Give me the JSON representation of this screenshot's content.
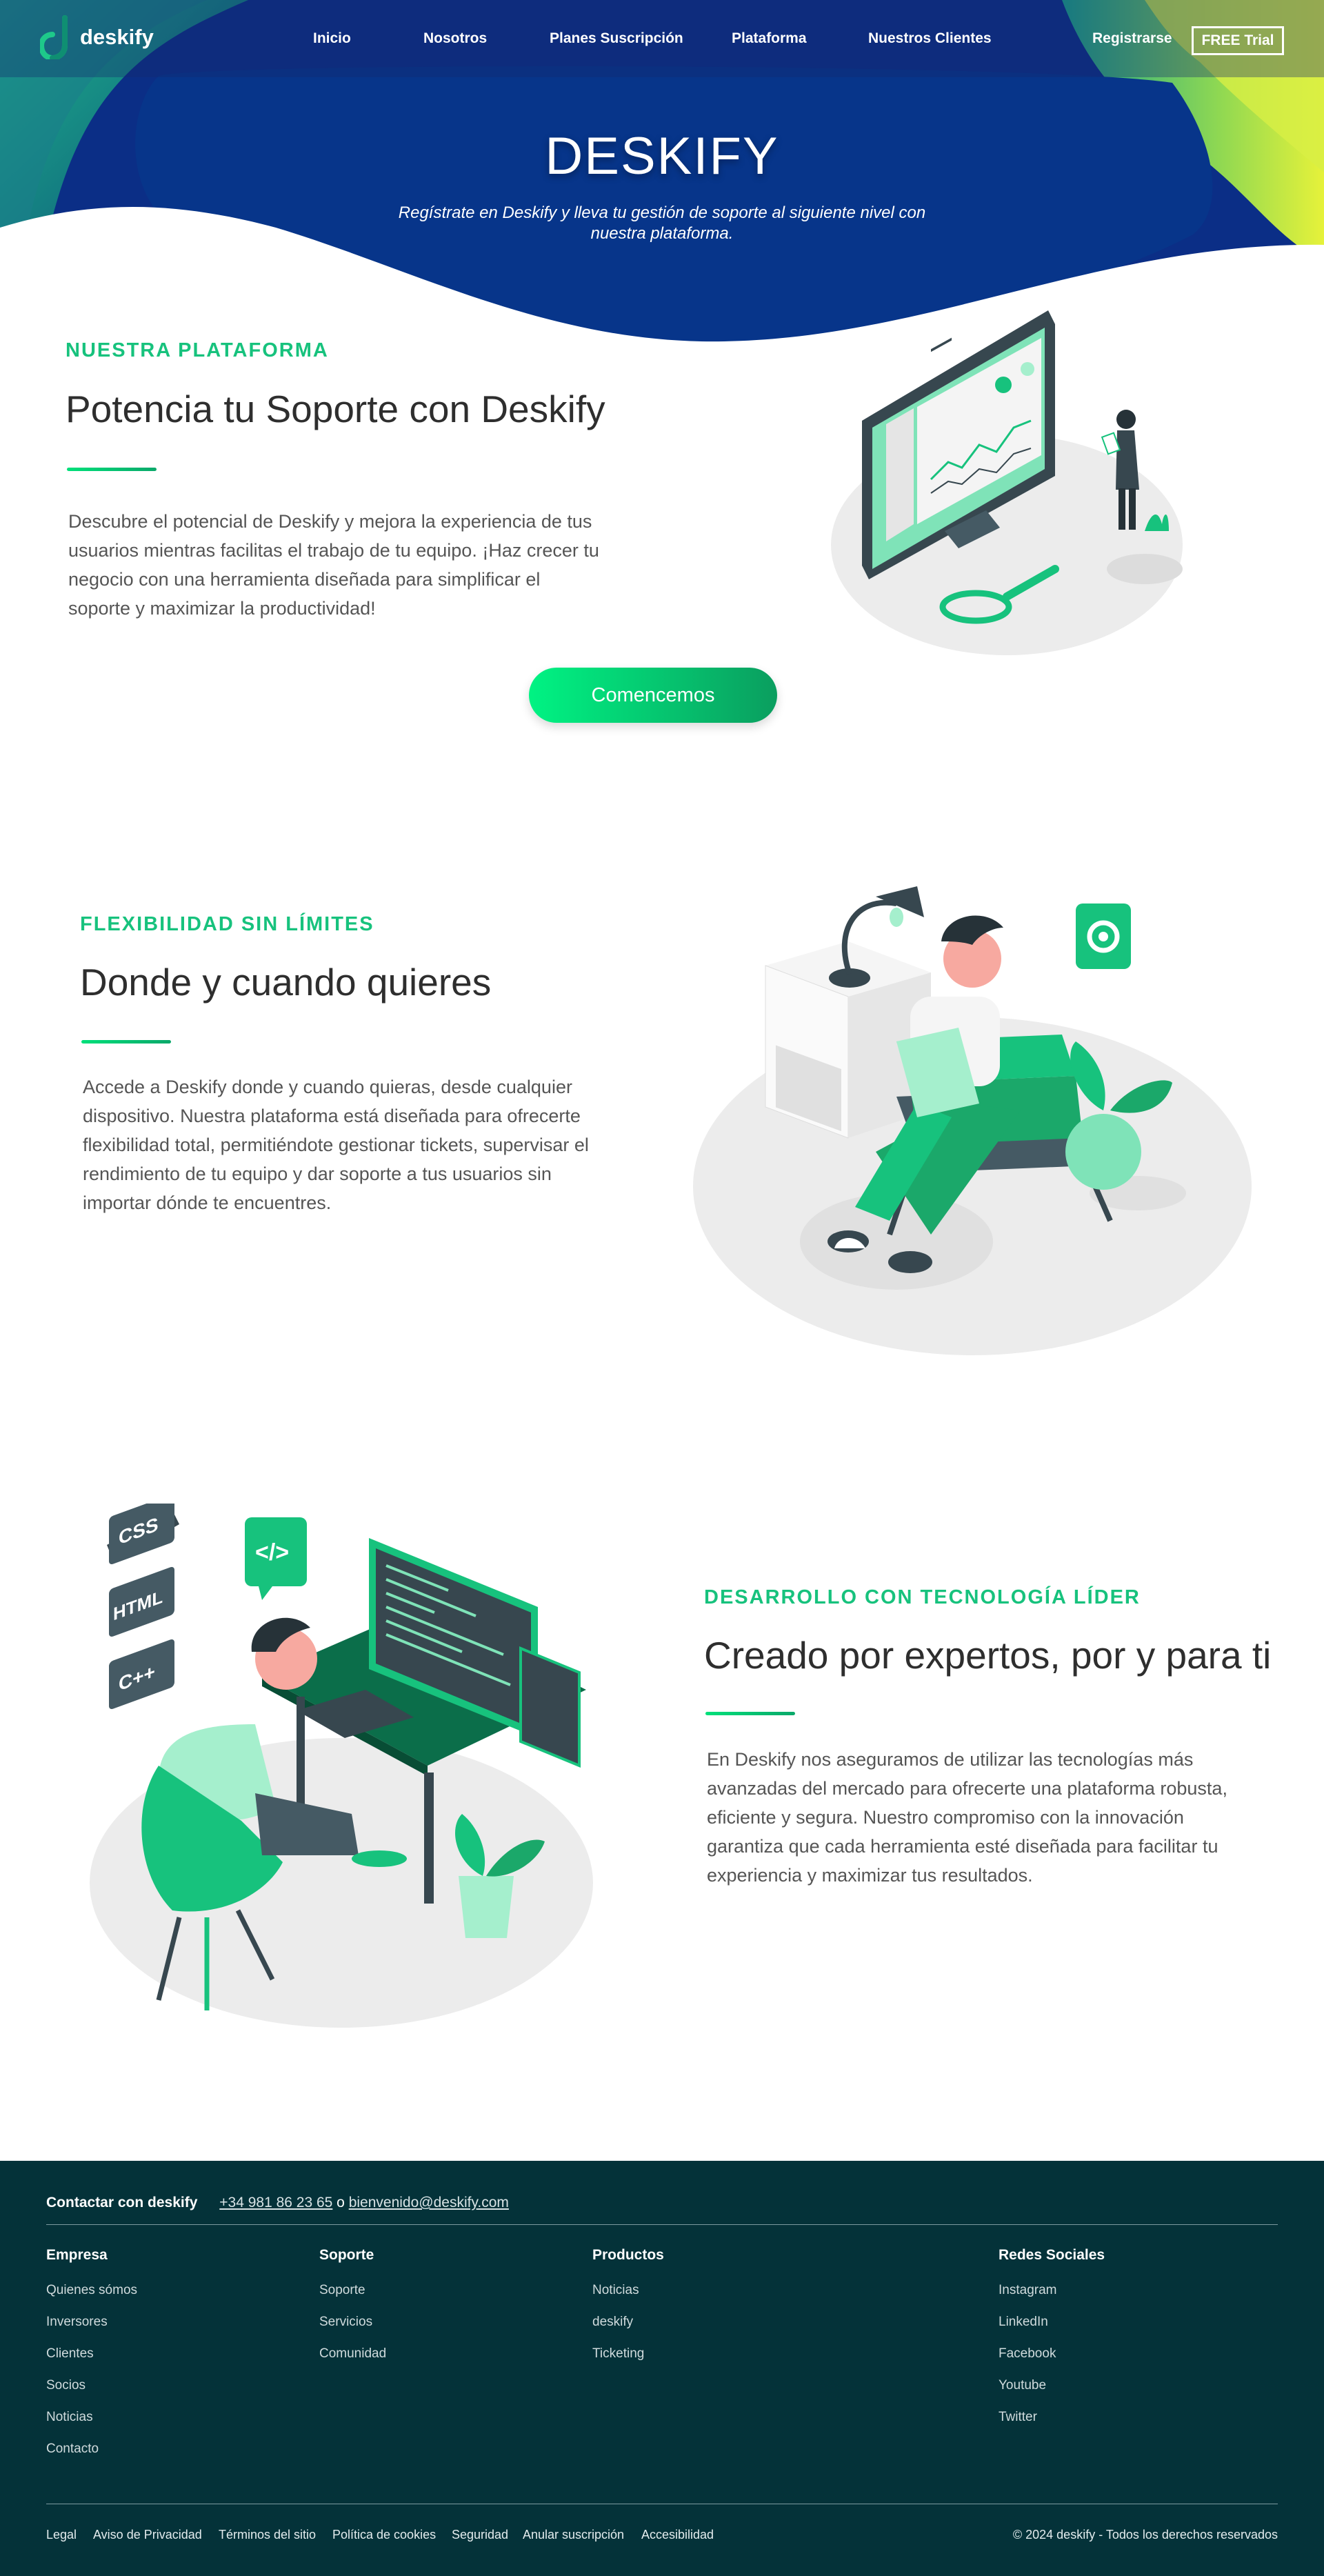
{
  "brand": {
    "name": "deskify"
  },
  "nav": {
    "links": [
      "Inicio",
      "Nosotros",
      "Planes Suscripción",
      "Plataforma",
      "Nuestros Clientes"
    ],
    "register": "Registrarse",
    "free_trial": "FREE Trial"
  },
  "hero": {
    "title": "DESKIFY",
    "subtitle": "Regístrate en Deskify y lleva tu gestión de soporte al siguiente nivel con nuestra plataforma."
  },
  "sections": [
    {
      "eyebrow": "NUESTRA PLATAFORMA",
      "title": "Potencia tu Soporte con Deskify",
      "text": "Descubre el potencial de Deskify y mejora la experiencia de tus usuarios mientras facilitas el trabajo de tu equipo. ¡Haz crecer tu negocio con una herramienta diseñada para simplificar el soporte y maximizar la productividad!",
      "cta": "Comencemos"
    },
    {
      "eyebrow": "FLEXIBILIDAD SIN LÍMITES",
      "title": "Donde y cuando quieres",
      "text": "Accede a Deskify donde y cuando quieras, desde cualquier dispositivo. Nuestra plataforma está diseñada para ofrecerte flexibilidad total, permitiéndote gestionar tickets, supervisar el rendimiento de tu equipo y dar soporte a tus usuarios sin importar dónde te encuentres."
    },
    {
      "eyebrow": "DESARROLLO CON TECNOLOGÍA LÍDER",
      "title": "Creado por expertos, por y para ti",
      "text": "En Deskify nos aseguramos de utilizar las tecnologías más avanzadas del mercado para ofrecerte una plataforma robusta, eficiente y segura. Nuestro compromiso con la innovación garantiza que cada herramienta esté diseñada para facilitar tu experiencia y maximizar tus resultados."
    }
  ],
  "illustration_text": {
    "css": "CSS",
    "html": "HTML",
    "cpp": "C++",
    "code": "</>"
  },
  "footer": {
    "contact_label": "Contactar con deskify",
    "phone": "+34 981 86 23 65",
    "or": "o",
    "email": "bienvenido@deskify.com",
    "columns": [
      {
        "title": "Empresa",
        "items": [
          "Quienes sómos",
          "Inversores",
          "Clientes",
          "Socios",
          "Noticias",
          "Contacto"
        ]
      },
      {
        "title": "Soporte",
        "items": [
          "Soporte",
          "Servicios",
          "Comunidad"
        ]
      },
      {
        "title": "Productos",
        "items": [
          "Noticias",
          "deskify",
          "Ticketing"
        ]
      },
      {
        "title": "Redes Sociales",
        "items": [
          "Instagram",
          "LinkedIn",
          "Facebook",
          "Youtube",
          "Twitter"
        ]
      }
    ],
    "bottom_links": [
      "Legal",
      "Aviso de Privacidad",
      "Términos del sitio",
      "Política de cookies",
      "Seguridad",
      "Anular suscripción",
      "Accesibilidad"
    ],
    "copyright": "© 2024 deskify - Todos los derechos reservados"
  },
  "colors": {
    "accent": "#17c27d",
    "hero_blue": "#07358a",
    "footer_bg": "#043239"
  }
}
